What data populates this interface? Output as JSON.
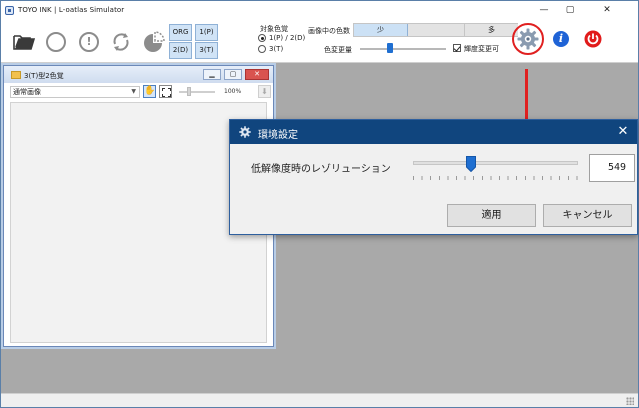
{
  "window": {
    "title": "TOYO INK | L-oatlas Simulator",
    "min_glyph": "—",
    "max_glyph": "▢",
    "close_glyph": "✕"
  },
  "toolbar": {
    "grid_buttons": {
      "org": "ORG",
      "p1": "1(P)",
      "d2": "2(D)",
      "t3": "3(T)"
    },
    "target_colors_label": "対象色覚",
    "radio_a_label": "1(P) / 2(D)",
    "radio_b_label": "3(T)",
    "radio_selected": "1(P) / 2(D)",
    "color_count_label": "画像中の色数",
    "seg_low": "少",
    "seg_high": "多",
    "color_change_label": "色変更量",
    "color_change_level": 0.35,
    "checkbox_label": "輝度変更可",
    "checkbox_checked": true,
    "info_glyph": "i"
  },
  "child_window": {
    "title": "3(T)型2色覚",
    "view_mode": "通常画像",
    "zoom": "100%",
    "close_glyph": "✕"
  },
  "dialog": {
    "title": "環境設定",
    "close_glyph": "✕",
    "resolution_label": "低解像度時のレゾリューション",
    "resolution_value": "549",
    "ok_label": "適用",
    "cancel_label": "キャンセル"
  },
  "colors": {
    "accent": "#1f6fd1",
    "dialog_title": "#10457e",
    "annotation": "#e02020"
  }
}
